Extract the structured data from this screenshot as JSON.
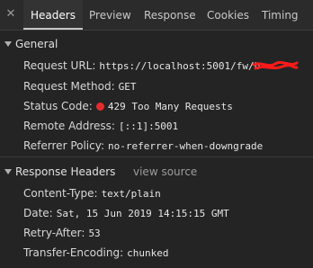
{
  "tabs": {
    "close_glyph": "✕",
    "items": [
      {
        "label": "Headers"
      },
      {
        "label": "Preview"
      },
      {
        "label": "Response"
      },
      {
        "label": "Cookies"
      },
      {
        "label": "Timing"
      }
    ],
    "active": "Headers"
  },
  "general": {
    "title": "General",
    "request_url_label": "Request URL:",
    "request_url_value": "https://localhost:5001/fw/b",
    "request_method_label": "Request Method:",
    "request_method_value": "GET",
    "status_code_label": "Status Code:",
    "status_code_value": "429 Too Many Requests",
    "status_color": "#e52b2b",
    "remote_address_label": "Remote Address:",
    "remote_address_value": "[::1]:5001",
    "referrer_policy_label": "Referrer Policy:",
    "referrer_policy_value": "no-referrer-when-downgrade"
  },
  "response_headers": {
    "title": "Response Headers",
    "view_source": "view source",
    "rows": [
      {
        "key": "Content-Type:",
        "value": "text/plain"
      },
      {
        "key": "Date:",
        "value": "Sat, 15 Jun 2019 14:15:15 GMT"
      },
      {
        "key": "Retry-After:",
        "value": "53"
      },
      {
        "key": "Transfer-Encoding:",
        "value": "chunked"
      }
    ]
  },
  "colors": {
    "background": "#242424",
    "tabbar": "#2b2b2b",
    "redaction": "#ff1a1a"
  }
}
